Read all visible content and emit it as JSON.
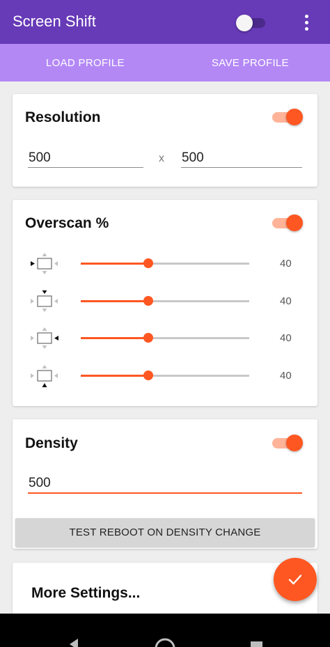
{
  "appbar": {
    "title": "Screen Shift",
    "master_enabled": false,
    "menu_icon": "more-vert-icon"
  },
  "profile": {
    "load_label": "LOAD PROFILE",
    "save_label": "SAVE PROFILE"
  },
  "resolution": {
    "title": "Resolution",
    "enabled": true,
    "width": "500",
    "separator": "x",
    "height": "500"
  },
  "overscan": {
    "title": "Overscan %",
    "enabled": true,
    "max": 100,
    "sliders": [
      {
        "side": "left",
        "icon": "overscan-left-icon",
        "value": 40
      },
      {
        "side": "top",
        "icon": "overscan-top-icon",
        "value": 40
      },
      {
        "side": "right",
        "icon": "overscan-right-icon",
        "value": 40
      },
      {
        "side": "bottom",
        "icon": "overscan-bottom-icon",
        "value": 40
      }
    ]
  },
  "density": {
    "title": "Density",
    "enabled": true,
    "value": "500",
    "test_reboot_label": "TEST REBOOT ON DENSITY CHANGE"
  },
  "more_settings": {
    "title": "More Settings..."
  },
  "fab": {
    "icon": "check-icon"
  },
  "colors": {
    "primary": "#673ab7",
    "secondary_bar": "#b388f5",
    "accent": "#ff5722"
  }
}
